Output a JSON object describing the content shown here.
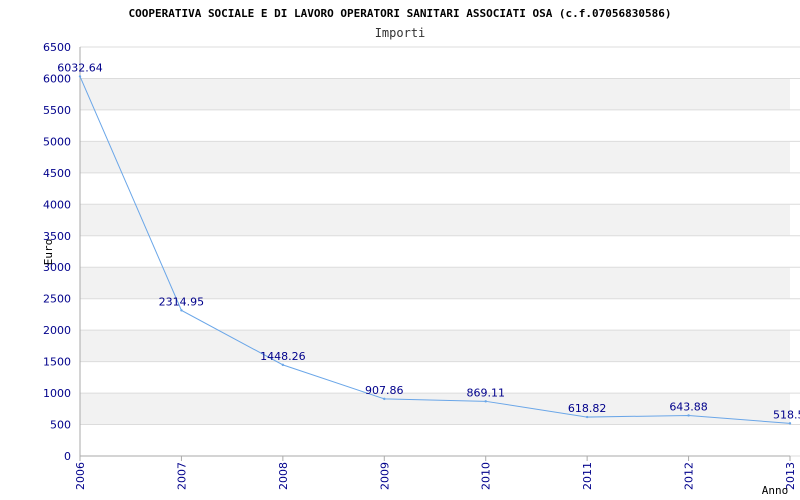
{
  "chart_data": {
    "type": "line",
    "title": "COOPERATIVA SOCIALE E DI LAVORO OPERATORI SANITARI ASSOCIATI OSA (c.f.07056830586)",
    "subtitle": "Importi",
    "xlabel": "Anno",
    "ylabel": "Euro",
    "x": [
      "2006",
      "2007",
      "2008",
      "2009",
      "2010",
      "2011",
      "2012",
      "2013"
    ],
    "series": [
      {
        "values": [
          6032.64,
          2314.95,
          1448.26,
          907.86,
          869.11,
          618.82,
          643.88,
          518.5
        ],
        "labels": [
          "6032.64",
          "2314.95",
          "1448.26",
          "907.86",
          "869.11",
          "618.82",
          "643.88",
          "518.5"
        ]
      }
    ],
    "ylim": [
      0,
      6500
    ],
    "yticks": [
      "0",
      "500",
      "1000",
      "1500",
      "2000",
      "2500",
      "3000",
      "3500",
      "4000",
      "4500",
      "5000",
      "5500",
      "6000",
      "6500"
    ],
    "grid": true,
    "colors": {
      "line": "#6aa6e8",
      "band": "#f2f2f2",
      "grid": "#dcdcdc",
      "axis": "#aaaaaa",
      "tick_text": "#00008b"
    }
  }
}
